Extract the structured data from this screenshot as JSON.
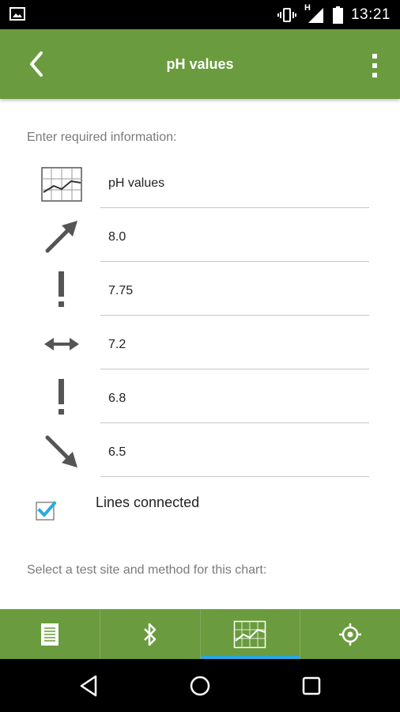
{
  "status_bar": {
    "time": "13:21",
    "network_label": "H",
    "icons": [
      "image-notification-icon",
      "vibrate-icon",
      "signal-icon",
      "battery-icon"
    ]
  },
  "app_bar": {
    "title": "pH values",
    "back_icon": "chevron-left-icon",
    "menu_icon": "overflow-menu-icon",
    "background_color": "#6a9b3e"
  },
  "form": {
    "prompt": "Enter required information:",
    "fields": [
      {
        "icon": "chart-icon",
        "value": "pH values"
      },
      {
        "icon": "arrow-up-right-icon",
        "value": "8.0"
      },
      {
        "icon": "exclamation-icon",
        "value": "7.75"
      },
      {
        "icon": "double-arrow-horizontal-icon",
        "value": "7.2"
      },
      {
        "icon": "exclamation-icon",
        "value": "6.8"
      },
      {
        "icon": "arrow-down-right-icon",
        "value": "6.5"
      }
    ],
    "lines_connected": {
      "label": "Lines connected",
      "checked": true,
      "accent_color": "#2aa9e0"
    },
    "site_prompt": "Select a test site and method for this chart:"
  },
  "bottom_nav": {
    "tabs": [
      {
        "icon": "document-icon",
        "active": false
      },
      {
        "icon": "bluetooth-icon",
        "active": false
      },
      {
        "icon": "chart-icon",
        "active": true
      },
      {
        "icon": "crosshair-icon",
        "active": false
      }
    ],
    "active_indicator_color": "#2aa9e0"
  },
  "system_nav": {
    "buttons": [
      "back-triangle-icon",
      "home-circle-icon",
      "recents-square-icon"
    ]
  }
}
